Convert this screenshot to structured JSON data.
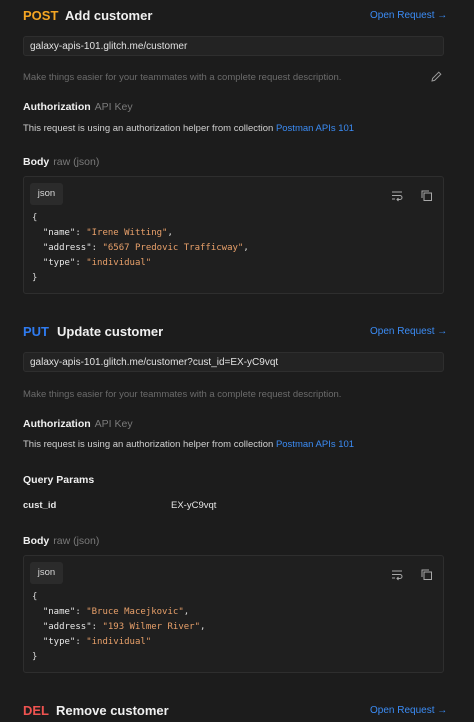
{
  "post": {
    "method": "POST",
    "title": "Add customer",
    "open_request": "Open Request →",
    "url": "galaxy-apis-101.glitch.me/customer",
    "description": "Make things easier for your teammates with a complete request description.",
    "auth_label": "Authorization",
    "auth_type": "API Key",
    "auth_text": "This request is using an authorization helper from collection ",
    "auth_link": "Postman APIs 101",
    "body_label": "Body",
    "body_type": "raw (json)",
    "json_tab": "json",
    "code": {
      "open": "{",
      "k1": "\"name\"",
      "v1": "\"Irene Witting\"",
      "k2": "\"address\"",
      "v2": "\"6567 Predovic Trafficway\"",
      "k3": "\"type\"",
      "v3": "\"individual\"",
      "close": "}"
    }
  },
  "put": {
    "method": "PUT",
    "title": "Update customer",
    "open_request": "Open Request →",
    "url": "galaxy-apis-101.glitch.me/customer?cust_id=EX-yC9vqt",
    "description": "Make things easier for your teammates with a complete request description.",
    "auth_label": "Authorization",
    "auth_type": "API Key",
    "auth_text": "This request is using an authorization helper from collection ",
    "auth_link": "Postman APIs 101",
    "query_label": "Query Params",
    "param_key": "cust_id",
    "param_value": "EX-yC9vqt",
    "body_label": "Body",
    "body_type": "raw (json)",
    "json_tab": "json",
    "code": {
      "open": "{",
      "k1": "\"name\"",
      "v1": "\"Bruce Macejkovic\"",
      "k2": "\"address\"",
      "v2": "\"193 Wilmer River\"",
      "k3": "\"type\"",
      "v3": "\"individual\"",
      "close": "}"
    }
  },
  "del": {
    "method": "DEL",
    "title": "Remove customer",
    "open_request": "Open Request →"
  },
  "icons": [
    "edit-pencil-icon",
    "wrap-lines-icon",
    "copy-icon"
  ]
}
